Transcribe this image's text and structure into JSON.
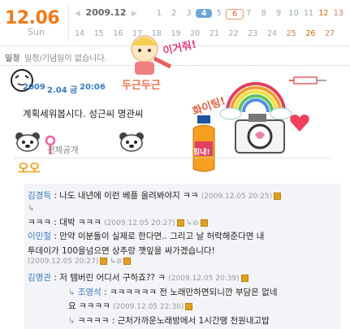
{
  "header": {
    "date": "12.06",
    "day": "Sun",
    "calendar_month": "2009.12",
    "calendar_row1": [
      "1",
      "2",
      "3",
      "4",
      "5",
      "6",
      "7",
      "8",
      "9",
      "10",
      "11",
      "12",
      "13"
    ],
    "calendar_row2": [
      "14",
      "15",
      "16",
      "17",
      "18",
      "19",
      "20",
      "21",
      "22",
      "23",
      "24",
      "25",
      "26",
      "27"
    ],
    "today": "4",
    "event_day": "6"
  },
  "schedule": {
    "label": "일정",
    "text": "일정/기념일이 없습니다."
  },
  "post": {
    "year": "2009",
    "date": "2.04 금",
    "time": "20:06",
    "body": "계획세워봅시다. 성근씨 명관씨",
    "visibility": "전체공개"
  },
  "stickers": {
    "text1": "두근두근",
    "text2": "이거줘!",
    "text3": "화이팅!",
    "text4": "힘내!",
    "text5": "오오"
  },
  "comments": [
    {
      "name": "김경득",
      "text": "나도 내년에 이런 베플 올려봐야지 ㅋㅋ",
      "date": "(2009.12.05 20:25)"
    },
    {
      "name": "ㅋㅋㅋ",
      "text": "대박 ㅋㅋㅋ",
      "date": "(2009.12.05 20:27)"
    },
    {
      "name": "이민철",
      "text": "만약 이분들이 실제로 한다면.. 그리고 날 허락해준다면 내",
      "text2": "투데이가 100을넘으면 상추랑 깻잎을 싸가겠습니다!",
      "date": "(2009.12.05 20:27)"
    },
    {
      "name": "김명관",
      "text": "저 템버린 어디서 구하죠?? ㅋ",
      "date": "(2009.12.05 20:39)"
    },
    {
      "name": "조영석",
      "text": "ㅋㅋㅋㅋㅋㅋ 전 노래만하면되니깐 부담은 없네",
      "text2": "요 ㅋㅋㅋㅋ",
      "date": "(2009.12.05 22:30)"
    },
    {
      "name": "",
      "text": "ㅋㅋㅋㅋ : 근처가까운노래방에서 1시간땡 천원내고밥",
      "date": ""
    }
  ],
  "colors": {
    "accent": "#f07a1a",
    "link": "#3a7ac0",
    "today_bg": "#6ea6d8"
  }
}
